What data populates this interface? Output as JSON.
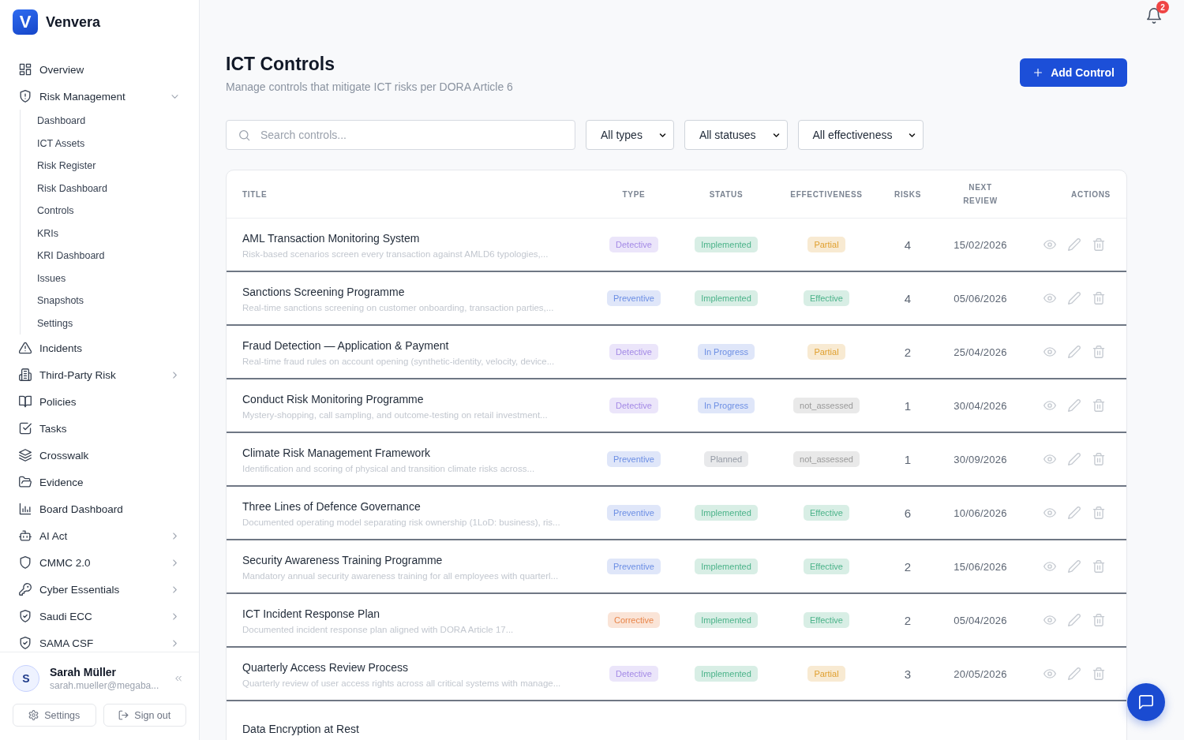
{
  "sidebar": {
    "logo": {
      "mark": "V",
      "name": "Venvera"
    },
    "nav": [
      {
        "label": "Overview",
        "kind": "link"
      },
      {
        "label": "Risk Management",
        "kind": "group",
        "expanded": true,
        "children": [
          {
            "label": "Dashboard"
          },
          {
            "label": "ICT Assets"
          },
          {
            "label": "Risk Register"
          },
          {
            "label": "Risk Dashboard"
          },
          {
            "label": "Controls"
          },
          {
            "label": "KRIs"
          },
          {
            "label": "KRI Dashboard"
          },
          {
            "label": "Issues"
          },
          {
            "label": "Snapshots"
          },
          {
            "label": "Settings"
          }
        ]
      },
      {
        "label": "Incidents",
        "kind": "link"
      },
      {
        "label": "Third-Party Risk",
        "kind": "group",
        "expanded": false
      },
      {
        "label": "Policies",
        "kind": "link"
      },
      {
        "label": "Tasks",
        "kind": "link"
      },
      {
        "label": "Crosswalk",
        "kind": "link"
      },
      {
        "label": "Evidence",
        "kind": "link"
      },
      {
        "label": "Board Dashboard",
        "kind": "link"
      },
      {
        "label": "AI Act",
        "kind": "group",
        "expanded": false
      },
      {
        "label": "CMMC 2.0",
        "kind": "group",
        "expanded": false
      },
      {
        "label": "Cyber Essentials",
        "kind": "group",
        "expanded": false
      },
      {
        "label": "Saudi ECC",
        "kind": "group",
        "expanded": false
      },
      {
        "label": "SAMA CSF",
        "kind": "group",
        "expanded": false
      }
    ],
    "user": {
      "initial": "S",
      "name": "Sarah Müller",
      "email": "sarah.mueller@megaba..."
    },
    "footer_buttons": [
      {
        "label": "Settings"
      },
      {
        "label": "Sign out"
      }
    ]
  },
  "topbar": {
    "notification_count": "2"
  },
  "header": {
    "title": "ICT Controls",
    "subtitle": "Manage controls that mitigate ICT risks per DORA Article 6",
    "action": "Add Control"
  },
  "filters": {
    "search": {
      "placeholder": "Search controls..."
    },
    "selects": [
      {
        "value": "All types"
      },
      {
        "value": "All statuses"
      },
      {
        "value": "All effectiveness"
      }
    ]
  },
  "table": {
    "columns": [
      "TITLE",
      "TYPE",
      "STATUS",
      "EFFECTIVENESS",
      "RISKS",
      "NEXT REVIEW",
      "ACTIONS"
    ],
    "rows": [
      {
        "title": "AML Transaction Monitoring System",
        "description": "Risk-based scenarios screen every transaction against AMLD6 typologies,...",
        "type": {
          "label": "Detective",
          "color": "#a48ae6"
        },
        "status": {
          "label": "Implemented",
          "color": "#4cb38a"
        },
        "effectiveness": {
          "label": "Partial",
          "color": "#e0a030"
        },
        "risks": "4",
        "next_review": "15/02/2026"
      },
      {
        "title": "Sanctions Screening Programme",
        "description": "Real-time sanctions screening on customer onboarding, transaction parties,...",
        "type": {
          "label": "Preventive",
          "color": "#6d8fe4"
        },
        "status": {
          "label": "Implemented",
          "color": "#4cb38a"
        },
        "effectiveness": {
          "label": "Effective",
          "color": "#4cb38a"
        },
        "risks": "4",
        "next_review": "05/06/2026"
      },
      {
        "title": "Fraud Detection — Application & Payment",
        "description": "Real-time fraud rules on account opening (synthetic-identity, velocity, device...",
        "type": {
          "label": "Detective",
          "color": "#a48ae6"
        },
        "status": {
          "label": "In Progress",
          "color": "#6d8fe4"
        },
        "effectiveness": {
          "label": "Partial",
          "color": "#e0a030"
        },
        "risks": "2",
        "next_review": "25/04/2026"
      },
      {
        "title": "Conduct Risk Monitoring Programme",
        "description": "Mystery-shopping, call sampling, and outcome-testing on retail investment...",
        "type": {
          "label": "Detective",
          "color": "#a48ae6"
        },
        "status": {
          "label": "In Progress",
          "color": "#6d8fe4"
        },
        "effectiveness": {
          "label": "not_assessed",
          "color": "#9a9a9a"
        },
        "risks": "1",
        "next_review": "30/04/2026"
      },
      {
        "title": "Climate Risk Management Framework",
        "description": "Identification and scoring of physical and transition climate risks across...",
        "type": {
          "label": "Preventive",
          "color": "#6d8fe4"
        },
        "status": {
          "label": "Planned",
          "color": "#959ba5"
        },
        "effectiveness": {
          "label": "not_assessed",
          "color": "#9a9a9a"
        },
        "risks": "1",
        "next_review": "30/09/2026"
      },
      {
        "title": "Three Lines of Defence Governance",
        "description": "Documented operating model separating risk ownership (1LoD: business), ris...",
        "type": {
          "label": "Preventive",
          "color": "#6d8fe4"
        },
        "status": {
          "label": "Implemented",
          "color": "#4cb38a"
        },
        "effectiveness": {
          "label": "Effective",
          "color": "#4cb38a"
        },
        "risks": "6",
        "next_review": "10/06/2026"
      },
      {
        "title": "Security Awareness Training Programme",
        "description": "Mandatory annual security awareness training for all employees with quarterl...",
        "type": {
          "label": "Preventive",
          "color": "#6d8fe4"
        },
        "status": {
          "label": "Implemented",
          "color": "#4cb38a"
        },
        "effectiveness": {
          "label": "Effective",
          "color": "#4cb38a"
        },
        "risks": "2",
        "next_review": "15/06/2026"
      },
      {
        "title": "ICT Incident Response Plan",
        "description": "Documented incident response plan aligned with DORA Article 17...",
        "type": {
          "label": "Corrective",
          "color": "#e8854a"
        },
        "status": {
          "label": "Implemented",
          "color": "#4cb38a"
        },
        "effectiveness": {
          "label": "Effective",
          "color": "#4cb38a"
        },
        "risks": "2",
        "next_review": "05/04/2026"
      },
      {
        "title": "Quarterly Access Review Process",
        "description": "Quarterly review of user access rights across all critical systems with manage...",
        "type": {
          "label": "Detective",
          "color": "#a48ae6"
        },
        "status": {
          "label": "Implemented",
          "color": "#4cb38a"
        },
        "effectiveness": {
          "label": "Partial",
          "color": "#e0a030"
        },
        "risks": "3",
        "next_review": "20/05/2026"
      },
      {
        "title": "Data Encryption at Rest"
      }
    ]
  }
}
